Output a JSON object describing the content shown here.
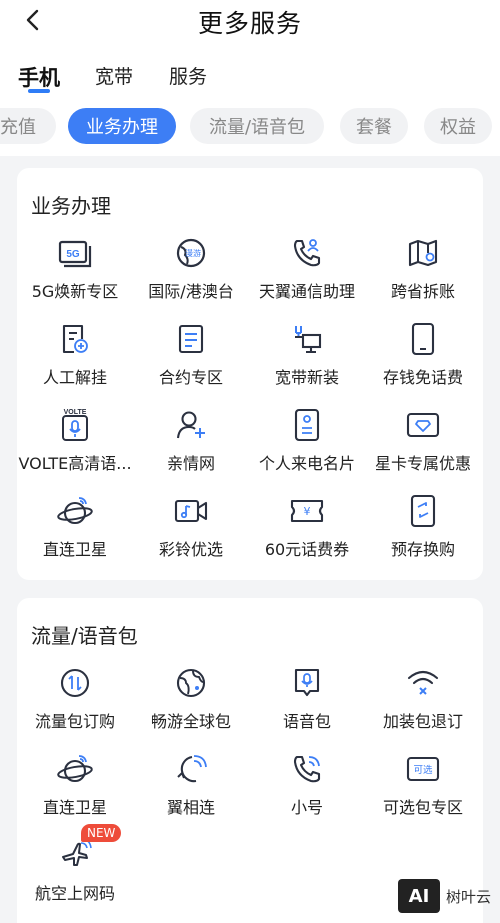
{
  "header": {
    "title": "更多服务"
  },
  "tabs": [
    {
      "label": "手机",
      "active": true
    },
    {
      "label": "宽带",
      "active": false
    },
    {
      "label": "服务",
      "active": false
    }
  ],
  "chips": [
    {
      "label": "充值",
      "active": false
    },
    {
      "label": "业务办理",
      "active": true
    },
    {
      "label": "流量/语音包",
      "active": false
    },
    {
      "label": "套餐",
      "active": false
    },
    {
      "label": "权益",
      "active": false
    }
  ],
  "sections": [
    {
      "title": "业务办理",
      "items": [
        {
          "label": "5G焕新专区",
          "icon": "5g-icon"
        },
        {
          "label": "国际/港澳台",
          "icon": "globe-icon"
        },
        {
          "label": "天翼通信助理",
          "icon": "phone-user-icon"
        },
        {
          "label": "跨省拆账",
          "icon": "map-icon"
        },
        {
          "label": "人工解挂",
          "icon": "document-add-icon"
        },
        {
          "label": "合约专区",
          "icon": "contract-icon"
        },
        {
          "label": "宽带新装",
          "icon": "broadband-icon"
        },
        {
          "label": "存钱免话费",
          "icon": "mobile-icon"
        },
        {
          "label": "VOLTE高清语...",
          "icon": "volte-icon"
        },
        {
          "label": "亲情网",
          "icon": "add-user-icon"
        },
        {
          "label": "个人来电名片",
          "icon": "caller-card-icon"
        },
        {
          "label": "星卡专属优惠",
          "icon": "diamond-card-icon"
        },
        {
          "label": "直连卫星",
          "icon": "satellite-icon"
        },
        {
          "label": "彩铃优选",
          "icon": "video-ringtone-icon"
        },
        {
          "label": "60元话费券",
          "icon": "coupon-icon"
        },
        {
          "label": "预存换购",
          "icon": "exchange-phone-icon"
        }
      ]
    },
    {
      "title": "流量/语音包",
      "items": [
        {
          "label": "流量包订购",
          "icon": "data-traffic-icon"
        },
        {
          "label": "畅游全球包",
          "icon": "global-travel-icon"
        },
        {
          "label": "语音包",
          "icon": "voice-pack-icon"
        },
        {
          "label": "加装包退订",
          "icon": "wifi-cancel-icon"
        },
        {
          "label": "直连卫星",
          "icon": "satellite-icon"
        },
        {
          "label": "翼相连",
          "icon": "connect-icon"
        },
        {
          "label": "小号",
          "icon": "phone-call-icon"
        },
        {
          "label": "可选包专区",
          "icon": "optional-pack-icon"
        },
        {
          "label": "航空上网码",
          "icon": "airplane-icon",
          "badge": "NEW"
        }
      ]
    }
  ],
  "optional_icon_text": "可选",
  "globe_icon_text": "漫游",
  "volte_icon_text": "VOLTE",
  "coupon_icon_text": "¥",
  "watermark": {
    "logo": "AI",
    "text": "树叶云"
  },
  "colors": {
    "accent": "#3d7ef5",
    "icon_dark": "#2b3140",
    "badge": "#ee4c3a"
  }
}
